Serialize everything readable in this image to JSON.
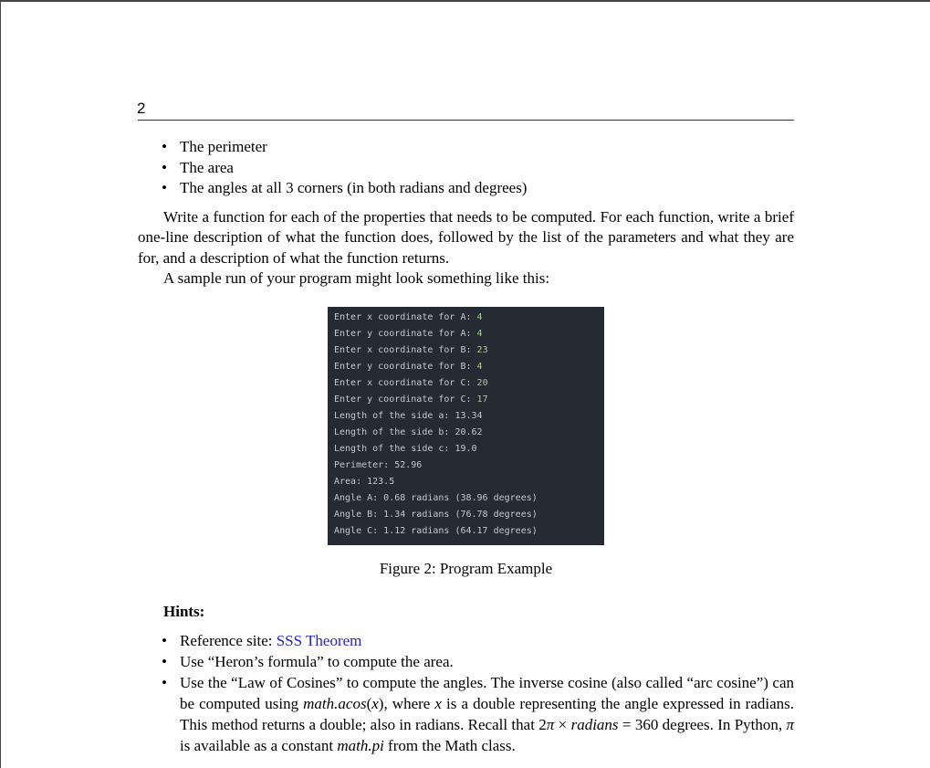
{
  "page": {
    "number": "2"
  },
  "properties_list": [
    "The perimeter",
    "The area",
    "The angles at all 3 corners (in both radians and degrees)"
  ],
  "instructions": "Write a function for each of the properties that needs to be computed. For each function, write a brief one-line description of what the function does, followed by the list of the parameters and what they are for, and a description of what the function returns.",
  "sample_intro": "A sample run of your program might look something like this:",
  "terminal": {
    "inputs": [
      {
        "prompt": "Enter x coordinate for A: ",
        "value": "4"
      },
      {
        "prompt": "Enter y coordinate for A: ",
        "value": "4"
      },
      {
        "prompt": "Enter x coordinate for B: ",
        "value": "23"
      },
      {
        "prompt": "Enter y coordinate for B: ",
        "value": "4"
      },
      {
        "prompt": "Enter x coordinate for C: ",
        "value": "20"
      },
      {
        "prompt": "Enter y coordinate for C: ",
        "value": "17"
      }
    ],
    "outputs": [
      "Length of the side a: 13.34",
      "Length of the side b: 20.62",
      "Length of the side c: 19.0",
      "Perimeter: 52.96",
      "Area: 123.5",
      "Angle A: 0.68 radians (38.96 degrees)",
      "Angle B: 1.34 radians (76.78 degrees)",
      "Angle C: 1.12 radians (64.17 degrees)"
    ]
  },
  "figure_caption": "Figure 2: Program Example",
  "hints": {
    "title": "Hints:",
    "reference_prefix": "Reference site: ",
    "reference_link": "SSS Theorem",
    "heron": "Use “Heron’s formula” to compute the area.",
    "cosines_1": "Use the “Law of Cosines” to compute the angles. The inverse cosine (also called “arc cosine”) can be computed using ",
    "cosines_func": "math.acos",
    "cosines_arg_open": "(",
    "cosines_x": "x",
    "cosines_arg_close": ")",
    "cosines_2": ", where ",
    "cosines_x2": "x",
    "cosines_3": " is a double representing the angle expressed in radians. This method returns a double; also in radians. Recall that 2",
    "pi": "π",
    "times": " × ",
    "radians": "radians",
    "equals_360": " = 360 degrees. In Python, ",
    "pi2": "π",
    "cosines_4": " is available as a constant ",
    "math_pi": "math.pi",
    "cosines_5": " from the Math class."
  },
  "colors": {
    "terminal_bg": "#262a33",
    "terminal_text": "#c5c8cc",
    "terminal_number": "#a8cc8c",
    "link": "#1f1fe0"
  }
}
